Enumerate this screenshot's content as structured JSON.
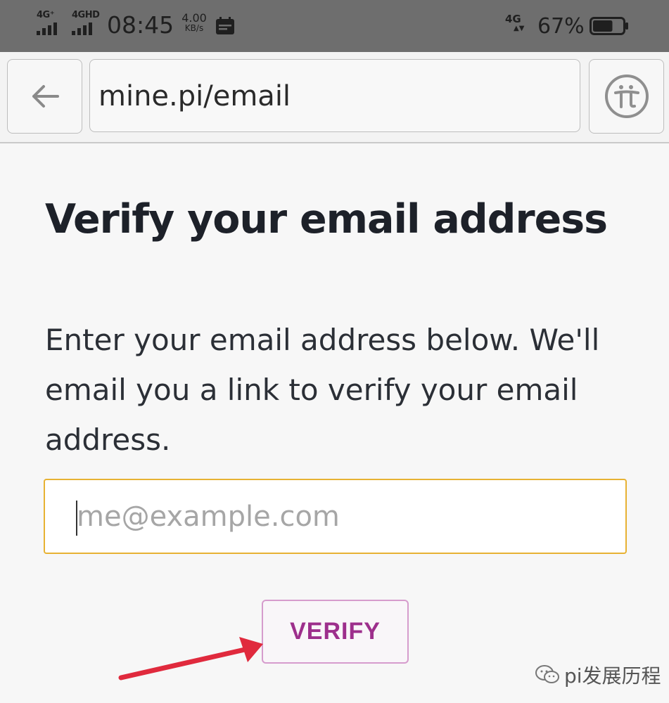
{
  "status_bar": {
    "sim1_network": "4G⁺",
    "sim2_network": "4GHD",
    "time": "08:45",
    "speed_value": "4.00",
    "speed_unit": "KB/s",
    "right_network": "4G",
    "battery_percent": "67%",
    "battery_level": 0.67,
    "icons": [
      "signal-icon",
      "calendar-icon",
      "data-arrows-icon",
      "battery-icon"
    ]
  },
  "browser": {
    "url": "mine.pi/email",
    "back_icon": "back-arrow-icon",
    "menu_icon": "pi-logo-icon"
  },
  "main": {
    "title": "Verify your email address",
    "instructions": "Enter your email address below. We'll email you a link to verify your email address.",
    "email_input": {
      "placeholder": "me@example.com",
      "value": ""
    },
    "verify_label": "VERIFY"
  },
  "watermark": {
    "text": "pi发展历程",
    "icon": "wechat-icon"
  },
  "colors": {
    "input_border": "#e7b233",
    "verify_text": "#9d2f8c",
    "verify_border": "#d69ccd",
    "annotation_arrow": "#e02a3d"
  }
}
